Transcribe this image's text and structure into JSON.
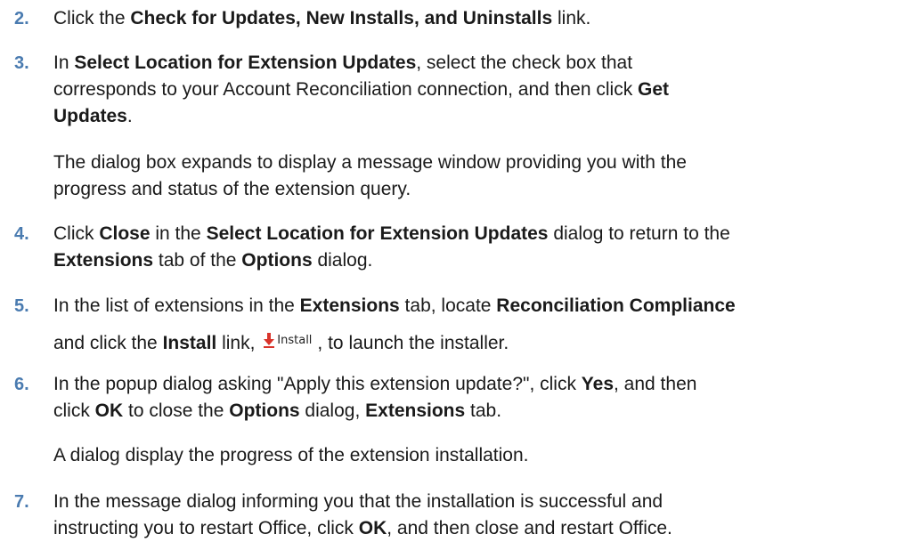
{
  "steps": [
    {
      "number": "2.",
      "segments": [
        {
          "text": "Click the ",
          "bold": false
        },
        {
          "text": "Check for Updates, New Installs, and Uninstalls",
          "bold": true
        },
        {
          "text": " link.",
          "bold": false
        }
      ]
    },
    {
      "number": "3.",
      "line1a": "In ",
      "line1b": "Select Location for Extension Updates",
      "line1c": ", select the check box that",
      "line2": "corresponds to your Account Reconciliation connection, and then click ",
      "line2b": "Get",
      "line3a": "Updates",
      "line3b": "."
    },
    {
      "number": "4.",
      "a": "Click ",
      "b": "Close",
      "c": " in the ",
      "d": "Select Location for Extension Updates",
      "e": " dialog to return to the",
      "f": "Extensions",
      "g": " tab of the ",
      "h": "Options",
      "i": " dialog."
    },
    {
      "number": "5.",
      "a": "In the list of extensions in the ",
      "b": "Extensions",
      "c": " tab, locate ",
      "d": "Reconciliation Compliance",
      "e": "and click the ",
      "f": "Install",
      "g": " link, ",
      "h": ", to launch the installer.",
      "icon_label": "Install",
      "icon_name": "install-arrow-icon"
    },
    {
      "number": "6.",
      "a": "In the popup dialog asking \"Apply this extension update?\", click ",
      "b": "Yes",
      "c": ", and then",
      "d": "click ",
      "e": "OK",
      "f": " to close the ",
      "g": "Options",
      "h": " dialog, ",
      "i": "Extensions",
      "j": " tab."
    },
    {
      "number": "7.",
      "a": "In the message dialog informing you that the installation is successful and",
      "b": "instructing you to restart Office, click ",
      "c": "OK",
      "d": ", and then close and restart Office."
    }
  ],
  "paragraphs": {
    "after_step3_line1": "The dialog box expands to display a message window providing you with the",
    "after_step3_line2": "progress and status of the extension query.",
    "after_step6": "A dialog display the progress of the extension installation."
  },
  "colors": {
    "step_number": "#4a7bb0",
    "text": "#1a1a1a",
    "install_arrow": "#d9342b"
  }
}
